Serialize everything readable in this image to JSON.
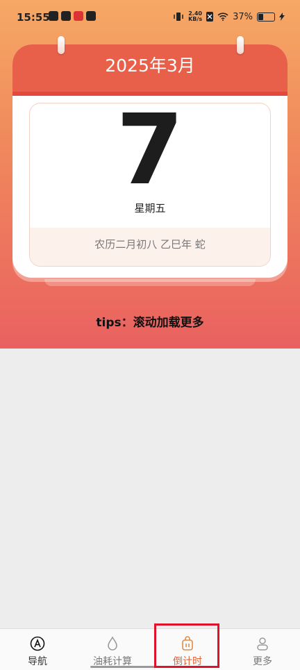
{
  "status_bar": {
    "time": "15:55",
    "net_speed_value": "2.40",
    "net_speed_unit": "KB/s",
    "battery": "37%",
    "battery_level": 0.37
  },
  "calendar": {
    "month_title": "2025年3月",
    "day": "7",
    "weekday": "星期五",
    "lunar": "农历二月初八 乙巳年 蛇"
  },
  "tips": "tips：滚动加载更多",
  "tabs": [
    {
      "label": "导航",
      "icon": "navigation-icon"
    },
    {
      "label": "油耗计算",
      "icon": "fuel-drop-icon"
    },
    {
      "label": "倒计时",
      "icon": "countdown-icon"
    },
    {
      "label": "更多",
      "icon": "user-more-icon"
    }
  ],
  "colors": {
    "header_red": "#e9604a",
    "active_tab": "#e0643a",
    "highlight_box": "#e0112a"
  }
}
